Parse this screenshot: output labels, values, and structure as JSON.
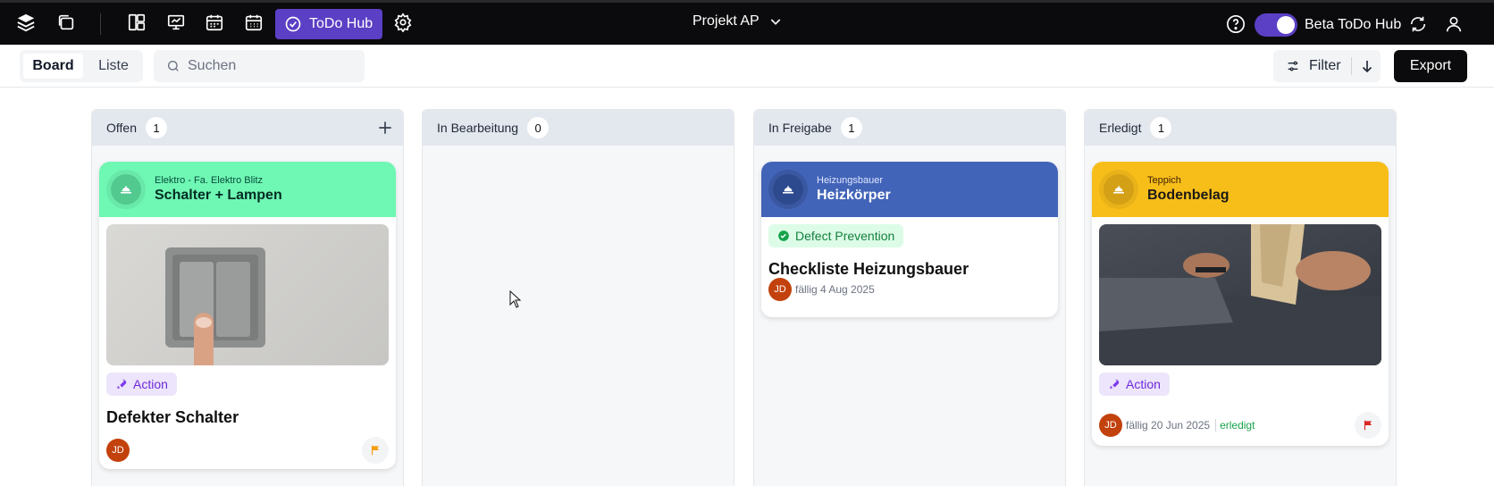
{
  "topbar": {
    "app_button_label": "ToDo Hub",
    "project": "Projekt AP",
    "beta_label": "Beta ToDo Hub",
    "beta_enabled": true,
    "icons": [
      "layers-icon",
      "documents-icon",
      "board-icon",
      "presentation-icon",
      "calendar-icon",
      "calendar-grid-icon",
      "check-circle-icon",
      "gear-icon",
      "help-icon",
      "sync-icon",
      "user-icon"
    ]
  },
  "toolbar": {
    "views": [
      "Board",
      "Liste"
    ],
    "active_view": "Board",
    "search_placeholder": "Suchen",
    "search_value": "",
    "filter_label": "Filter",
    "export_label": "Export"
  },
  "colors": {
    "accent": "#5b3fc4",
    "elektro": "#6ff7b4",
    "heizung": "#4264b8",
    "teppich": "#f7be1a"
  },
  "columns": [
    {
      "title": "Offen",
      "count": "1",
      "cards": [
        {
          "category": "Elektro - Fa. Elektro Blitz",
          "title": "Schalter + Lampen",
          "tag": "Action",
          "task": "Defekter Schalter",
          "avatar": "JD",
          "flag": "orange"
        }
      ]
    },
    {
      "title": "In Bearbeitung",
      "count": "0",
      "cards": []
    },
    {
      "title": "In Freigabe",
      "count": "1",
      "cards": [
        {
          "category": "Heizungsbauer",
          "title": "Heizkörper",
          "tag": "Defect Prevention",
          "task": "Checkliste Heizungsbauer",
          "avatar": "JD",
          "due": "fällig 4 Aug 2025"
        }
      ]
    },
    {
      "title": "Erledigt",
      "count": "1",
      "cards": [
        {
          "category": "Teppich",
          "title": "Bodenbelag",
          "tag": "Action",
          "avatar": "JD",
          "due": "fällig 20 Jun 2025",
          "status": "erledigt",
          "flag": "red"
        }
      ]
    }
  ]
}
